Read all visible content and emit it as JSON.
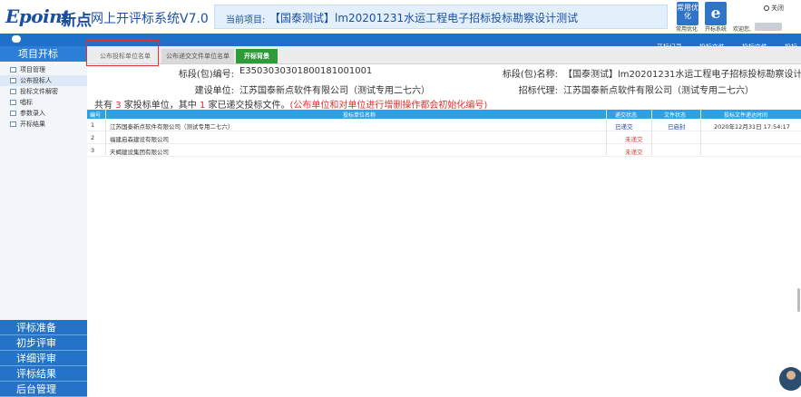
{
  "header": {
    "logo": "Epoint",
    "logo_cn": "新点",
    "app_title": "网上开评标系统V7.0",
    "project_label": "当前项目:",
    "project_name": "【国泰测试】lm20201231水运工程电子招标投标勘察设计测试",
    "tool1": {
      "label": "常用优化",
      "caption": "常用优化"
    },
    "tool2": {
      "label": "e",
      "caption": "开标系统"
    },
    "welcome": "欢迎您,",
    "close": "关闭"
  },
  "topnav": [
    "开标记录",
    "投标文件",
    "投标文件",
    "投标"
  ],
  "sidebar": {
    "title": "项目开标",
    "items": [
      "项目管理",
      "公布投标人",
      "投标文件解密",
      "唱标",
      "参数录入",
      "开标结果"
    ],
    "active": 1,
    "sections": [
      "评标准备",
      "初步评审",
      "详细评审",
      "评标结果",
      "后台管理"
    ]
  },
  "tabs": [
    "公布投标单位名单",
    "公布递交文件单位名单",
    "开标背景"
  ],
  "info": {
    "section_no_label": "标段(包)编号:",
    "section_no": "E3503030301800181001001",
    "section_name_label": "标段(包)名称:",
    "section_name": "【国泰测试】lm20201231水运工程电子招标投标勘察设计测试",
    "builder_label": "建设单位:",
    "builder": "江苏国泰新点软件有限公司（测试专用二七六）",
    "agent_label": "招标代理:",
    "agent": "江苏国泰新点软件有限公司（测试专用二七六）"
  },
  "summary": {
    "prefix": "共有",
    "total": "3",
    "mid": "家投标单位，其中",
    "submitted": "1",
    "suffix": "家已递交投标文件。",
    "warning": "(公布单位和对单位进行增删操作都会初始化编号)"
  },
  "table": {
    "headers": [
      "编号",
      "投标单位名称",
      "递交状态",
      "文件状态",
      "投标文件递达时间"
    ],
    "rows": [
      {
        "no": "1",
        "name": "江苏国泰新点软件有限公司（测试专用二七六）",
        "submit": "已递交",
        "file": "已启封",
        "time": "2020年12月31日 17:54:17"
      },
      {
        "no": "2",
        "name": "福建启森建设有限公司",
        "submit": "未递交",
        "file": "",
        "time": ""
      },
      {
        "no": "3",
        "name": "天蝎建设集团有限公司",
        "submit": "未递交",
        "file": "",
        "time": ""
      }
    ]
  },
  "colors": {
    "accent": "#1e70c9",
    "table_header": "#2fa0e4",
    "warning": "#e0322f",
    "active_tab": "#2e9a3a"
  }
}
